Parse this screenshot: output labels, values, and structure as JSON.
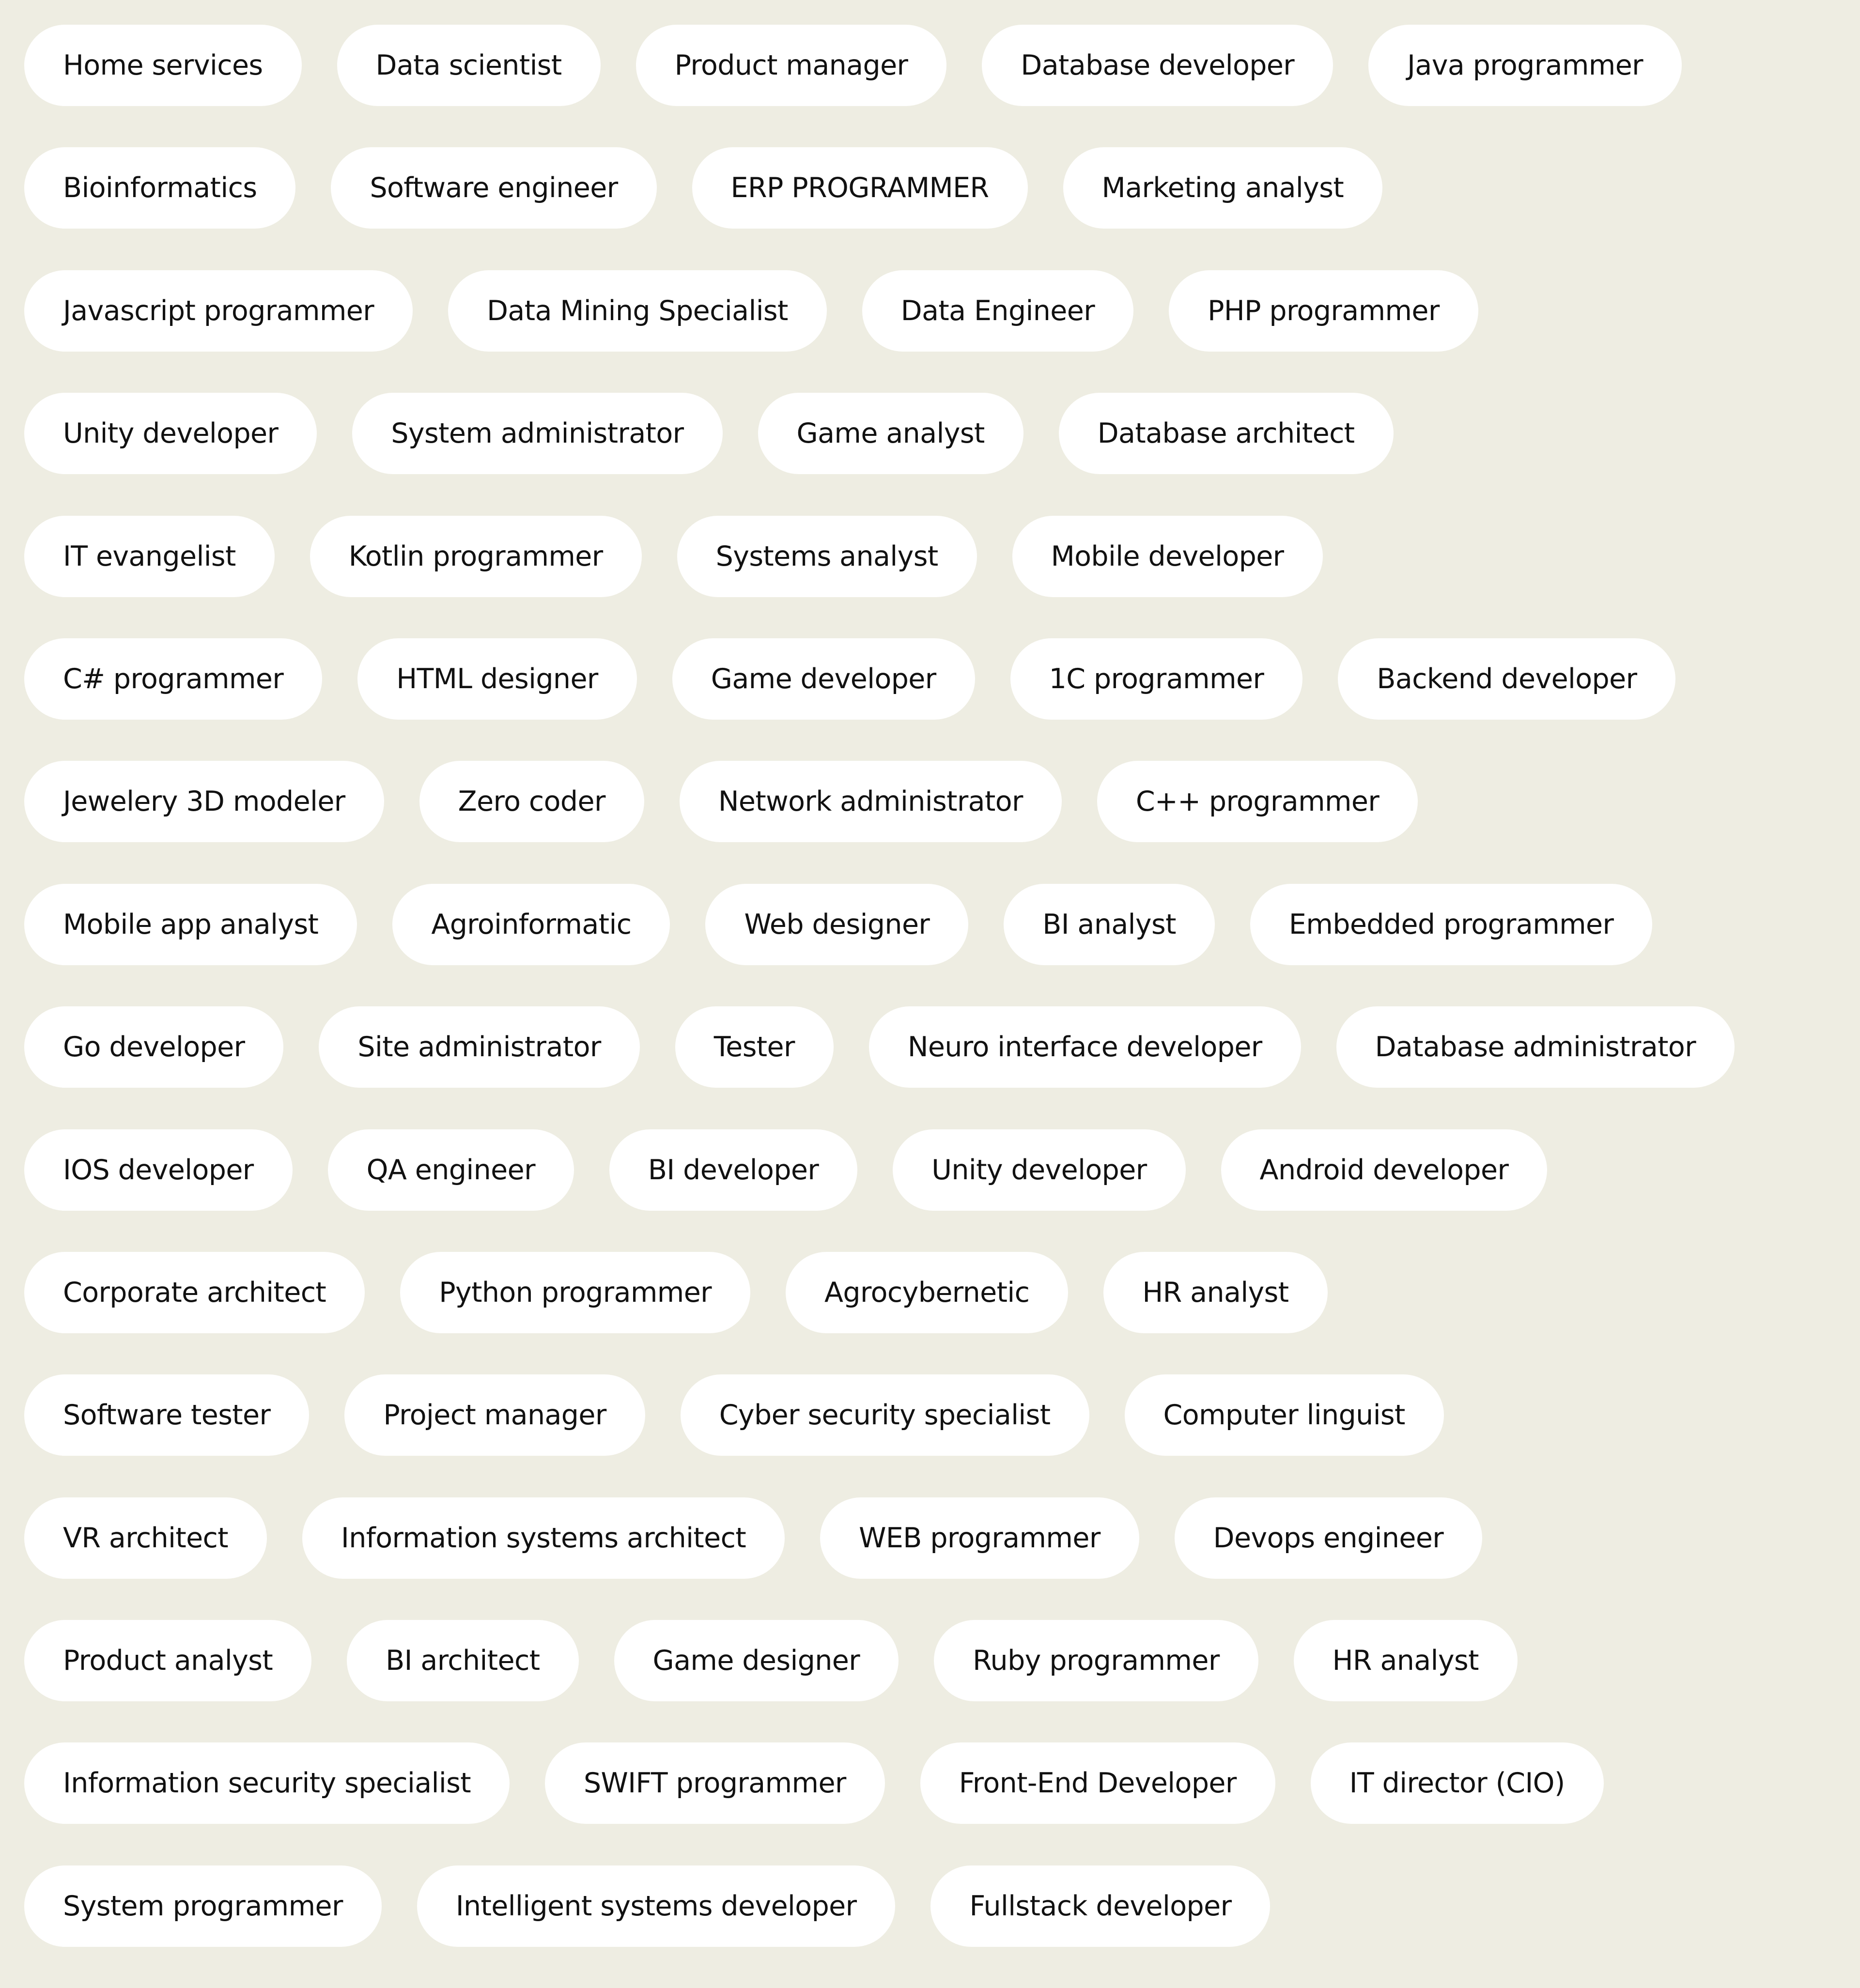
{
  "colors": {
    "background": "#eeede2",
    "tag_background": "#ffffff",
    "tag_text": "#111111"
  },
  "tag_rows": [
    [
      "Home services",
      "Data scientist",
      "Product manager",
      "Database developer",
      "Java programmer"
    ],
    [
      "Bioinformatics",
      "Software engineer",
      "ERP PROGRAMMER",
      "Marketing analyst"
    ],
    [
      "Javascript programmer",
      "Data Mining Specialist",
      "Data Engineer",
      "PHP programmer"
    ],
    [
      "Unity developer",
      "System administrator",
      "Game analyst",
      "Database architect"
    ],
    [
      "IT evangelist",
      "Kotlin programmer",
      "Systems analyst",
      "Mobile developer"
    ],
    [
      "C# programmer",
      "HTML designer",
      "Game developer",
      "1C programmer",
      "Backend developer"
    ],
    [
      "Jewelery 3D modeler",
      "Zero coder",
      "Network administrator",
      "C++ programmer"
    ],
    [
      "Mobile app analyst",
      "Agroinformatic",
      "Web designer",
      "BI analyst",
      "Embedded programmer"
    ],
    [
      "Go developer",
      "Site administrator",
      "Tester",
      "Neuro interface developer",
      "Database administrator"
    ],
    [
      "IOS developer",
      "QA engineer",
      "BI developer",
      "Unity developer",
      "Android developer"
    ],
    [
      "Corporate architect",
      "Python programmer",
      "Agrocybernetic",
      "HR analyst"
    ],
    [
      "Software tester",
      "Project manager",
      "Cyber security specialist",
      "Computer linguist"
    ],
    [
      "VR architect",
      "Information systems architect",
      "WEB programmer",
      "Devops engineer"
    ],
    [
      "Product analyst",
      "BI architect",
      "Game designer",
      "Ruby programmer",
      "HR analyst"
    ],
    [
      "Information security specialist",
      "SWIFT programmer",
      "Front-End Developer",
      "IT director (CIO)"
    ],
    [
      "System programmer",
      "Intelligent systems developer",
      "Fullstack developer"
    ]
  ]
}
